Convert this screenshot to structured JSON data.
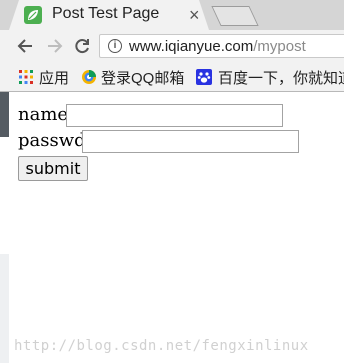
{
  "browser": {
    "tab": {
      "title": "Post Test Page",
      "close_glyph": "×",
      "favicon": "leaf-icon"
    },
    "toolbar": {
      "back_icon": "back-arrow-icon",
      "forward_icon": "forward-arrow-icon",
      "reload_icon": "reload-icon",
      "url_host": "www.iqianyue.com",
      "url_path": "/mypost"
    },
    "bookmarks": [
      {
        "label": "应用",
        "icon": "apps-grid-icon"
      },
      {
        "label": "登录QQ邮箱",
        "icon": "qq-mail-icon"
      },
      {
        "label": "百度一下，你就知道",
        "icon": "baidu-paw-icon"
      }
    ]
  },
  "form": {
    "name_label": "name:",
    "name_value": "",
    "passwd_label": "passwd:",
    "passwd_value": "",
    "submit_label": "submit"
  },
  "watermark": "http://blog.csdn.net/fengxinlinux",
  "colors": {
    "tabstrip": "#d5d5d5",
    "toolbar": "#f2f2f2",
    "favicon_green": "#4caf50",
    "url_path_gray": "#8a8a8a"
  }
}
